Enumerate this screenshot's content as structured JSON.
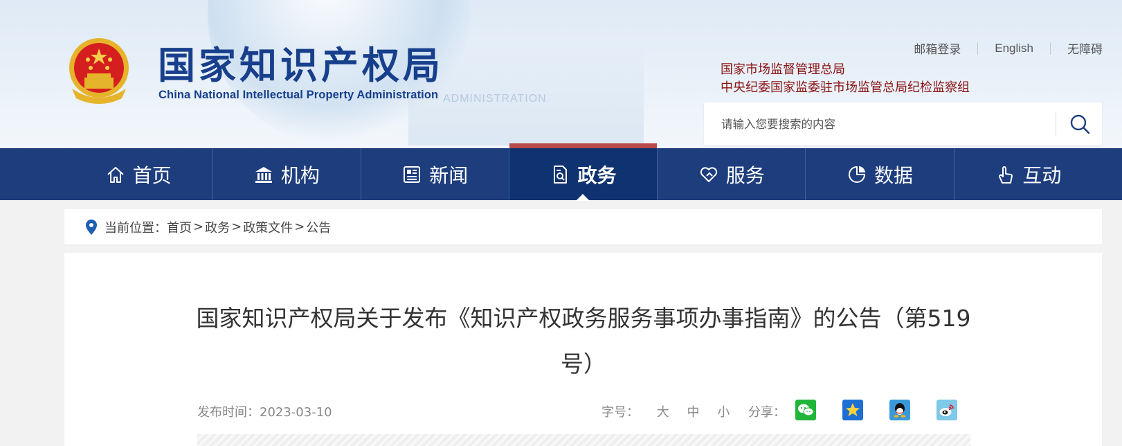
{
  "header": {
    "logo_cn": "国家知识产权局",
    "logo_en": "China National Intellectual Property Administration",
    "logo_ghost": "ADMINISTRATION",
    "top_links": [
      "邮箱登录",
      "English",
      "无障碍"
    ],
    "sub_links": [
      "国家市场监督管理总局",
      "中央纪委国家监委驻市场监管总局纪检监察组"
    ],
    "search_placeholder": "请输入您要搜索的内容"
  },
  "nav": {
    "items": [
      {
        "label": "首页",
        "icon": "home-icon"
      },
      {
        "label": "机构",
        "icon": "institution-icon"
      },
      {
        "label": "新闻",
        "icon": "newspaper-icon"
      },
      {
        "label": "政务",
        "icon": "document-icon",
        "active": true
      },
      {
        "label": "服务",
        "icon": "heart-hand-icon"
      },
      {
        "label": "数据",
        "icon": "pie-chart-icon"
      },
      {
        "label": "互动",
        "icon": "pointer-hand-icon"
      }
    ]
  },
  "breadcrumb": {
    "prefix": "当前位置：",
    "items": [
      "首页",
      "政务",
      "政策文件",
      "公告"
    ],
    "separator": ">"
  },
  "article": {
    "title": "国家知识产权局关于发布《知识产权政务服务事项办事指南》的公告（第519号）",
    "date_label": "发布时间：2023-03-10",
    "font_size_label": "字号：",
    "font_sizes": [
      "大",
      "中",
      "小"
    ],
    "share_label": "分享："
  },
  "colors": {
    "nav_bg": "#1d3d7d",
    "nav_active": "#0f3270",
    "nav_active_bar": "#b84a4a",
    "logo_blue": "#173f8c",
    "sub_link_red": "#8a1212"
  }
}
